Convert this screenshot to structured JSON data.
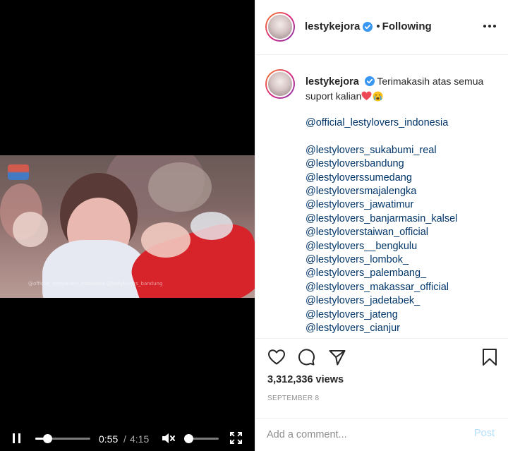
{
  "video": {
    "watermark": "@official_lestylovers_indonesia   @lestylovers_bandung",
    "current_time": "0:55",
    "time_separator": "/",
    "total_time": "4:15",
    "progress_fraction": 0.216,
    "volume_fraction": 0.1
  },
  "header": {
    "username": "lestykejora",
    "dot": "•",
    "follow_status": "Following"
  },
  "caption": {
    "username": "lestykejora",
    "message": "Terimakasih atas semua suport kalian",
    "tags": [
      "@official_lestylovers_indonesia",
      "",
      "@lestylovers_sukabumi_real",
      "@lestyloversbandung",
      "@lestyloverssumedang",
      "@lestyloversmajalengka",
      "@lestylovers_jawatimur",
      "@lestylovers_banjarmasin_kalsel",
      "@lestyloverstaiwan_official",
      "@lestylovers__bengkulu",
      "@lestylovers_lombok_",
      "@lestylovers_palembang_",
      "@lestylovers_makassar_official",
      "@lestylovers_jadetabek_",
      "@lestylovers_jateng",
      "@lestylovers_cianjur"
    ]
  },
  "stats": {
    "views": "3,312,336 views",
    "date": "SEPTEMBER 8"
  },
  "comment": {
    "placeholder": "Add a comment...",
    "post_label": "Post"
  },
  "colors": {
    "link": "#003569",
    "verified": "#3897f0",
    "post_disabled": "#b2dffc",
    "heart": "#ed4956"
  },
  "icons": [
    "pause-icon",
    "mute-icon",
    "fullscreen-icon",
    "verified-icon",
    "more-icon",
    "heart-emoji-icon",
    "crying-emoji-icon",
    "like-icon",
    "comment-icon",
    "share-icon",
    "save-icon"
  ]
}
